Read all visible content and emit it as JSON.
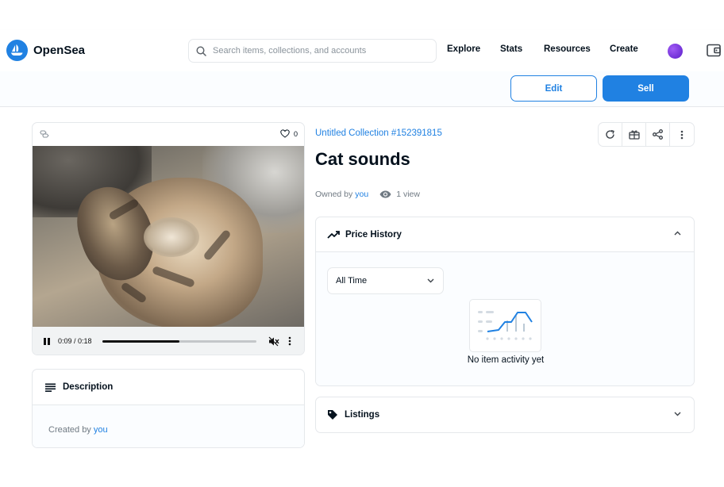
{
  "header": {
    "brand": "OpenSea",
    "search_placeholder": "Search items, collections, and accounts",
    "nav": [
      "Explore",
      "Stats",
      "Resources",
      "Create"
    ]
  },
  "actions": {
    "edit": "Edit",
    "sell": "Sell"
  },
  "media": {
    "favorites": "0",
    "time": "0:09 / 0:18",
    "progress": 0.5
  },
  "description": {
    "title": "Description",
    "created_by": "Created by",
    "creator": "you"
  },
  "item": {
    "collection": "Untitled Collection #152391815",
    "title": "Cat sounds",
    "owned_by": "Owned by",
    "owner": "you",
    "views": "1 view"
  },
  "price_history": {
    "title": "Price History",
    "filter": "All Time",
    "empty": "No item activity yet"
  },
  "listings": {
    "title": "Listings"
  },
  "colors": {
    "accent": "#2081e2",
    "text": "#04111d",
    "muted": "#707a83"
  }
}
